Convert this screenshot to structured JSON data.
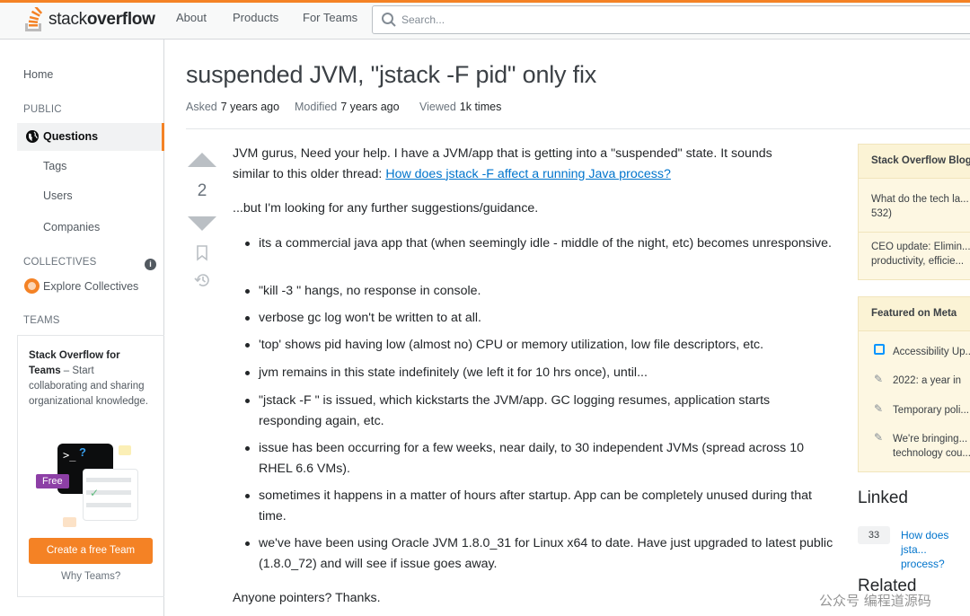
{
  "header": {
    "logo_text_light": "stack",
    "logo_text_bold": "overflow",
    "nav": [
      "About",
      "Products",
      "For Teams"
    ],
    "search_placeholder": "Search..."
  },
  "sidebar": {
    "home": "Home",
    "public_heading": "PUBLIC",
    "questions": "Questions",
    "tags": "Tags",
    "users": "Users",
    "companies": "Companies",
    "collectives_heading": "COLLECTIVES",
    "explore_collectives": "Explore Collectives",
    "teams_heading": "TEAMS",
    "teams_title": "Stack Overflow for Teams",
    "teams_desc": " – Start collaborating and sharing organizational knowledge.",
    "badge_free": "Free",
    "cta": "Create a free Team",
    "why_teams": "Why Teams?"
  },
  "question": {
    "title": "suspended JVM, \"jstack -F pid\" only fix",
    "asked_label": "Asked",
    "asked_value": "7 years ago",
    "modified_label": "Modified",
    "modified_value": "7 years ago",
    "viewed_label": "Viewed",
    "viewed_value": "1k times",
    "score": "2",
    "intro": "JVM gurus, Need your help. I have a JVM/app that is getting into a \"suspended\" state. It sounds similar to this older thread: ",
    "intro_link": "How does jstack -F affect a running Java process?",
    "para2": "...but I'm looking for any further suggestions/guidance.",
    "bullets": [
      "its a commercial java app that (when seemingly idle - middle of the night, etc) becomes unresponsive.",
      "\"kill -3 \" hangs, no response in console.",
      "verbose gc log won't be written to at all.",
      "'top' shows pid having low (almost no) CPU or memory utilization, low file descriptors, etc.",
      "jvm remains in this state indefinitely (we left it for 10 hrs once), until...",
      "\"jstack -F \" is issued, which kickstarts the JVM/app. GC logging resumes, application starts responding again, etc.",
      "issue has been occurring for a few weeks, near daily, to 30 independent JVMs (spread across 10 RHEL 6.6 VMs).",
      "sometimes it happens in a matter of hours after startup. App can be completely unused during that time.",
      "we've have been using Oracle JVM 1.8.0_31 for Linux x64 to date. Have just upgraded to latest public (1.8.0_72) and will see if issue goes away."
    ],
    "closing": "Anyone pointers? Thanks."
  },
  "right": {
    "blog_heading": "Stack Overflow Blog",
    "blog_items": [
      "What do the tech la... 532)",
      "CEO update: Elimin... productivity, efficie..."
    ],
    "meta_heading": "Featured on Meta",
    "meta_items": [
      "Accessibility Up...",
      "2022: a year in",
      "Temporary poli...",
      "We're bringing... technology cou..."
    ],
    "linked_heading": "Linked",
    "linked_score": "33",
    "linked_link": "How does jsta... process?",
    "related_heading": "Related"
  },
  "watermark": "公众号 编程道源码"
}
